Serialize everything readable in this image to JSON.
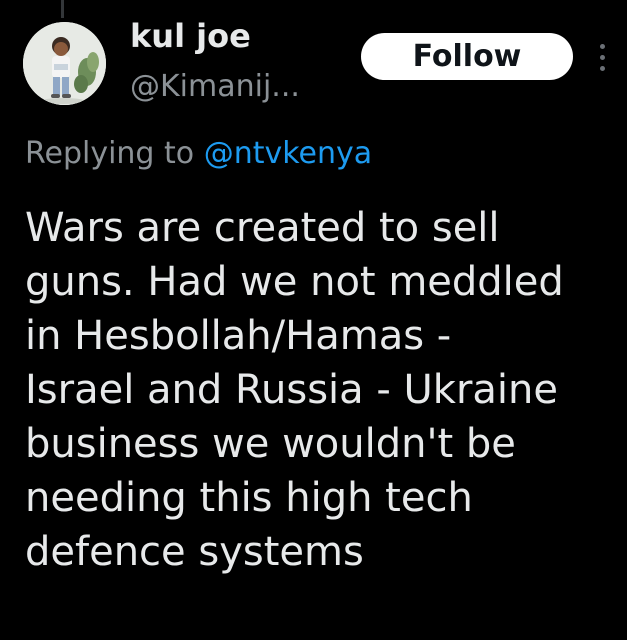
{
  "author": {
    "name": "kul joe",
    "handle": "@Kimanij..."
  },
  "follow_button": {
    "label": "Follow"
  },
  "more_icon": "more-vertical-icon",
  "reply": {
    "prefix": "Replying to",
    "target": "@ntvkenya"
  },
  "tweet": {
    "lines": [
      "Wars are created to sell",
      "guns. Had we not meddled",
      "in Hesbollah/Hamas -",
      "Israel and Russia - Ukraine",
      "business we wouldn't be",
      "needing this high tech",
      "defence systems"
    ]
  },
  "colors": {
    "background": "#000000",
    "text": "#e7e9ea",
    "secondary": "#8b9196",
    "link": "#1d9bf0",
    "button_bg": "#ffffff",
    "button_text": "#0f1419"
  }
}
